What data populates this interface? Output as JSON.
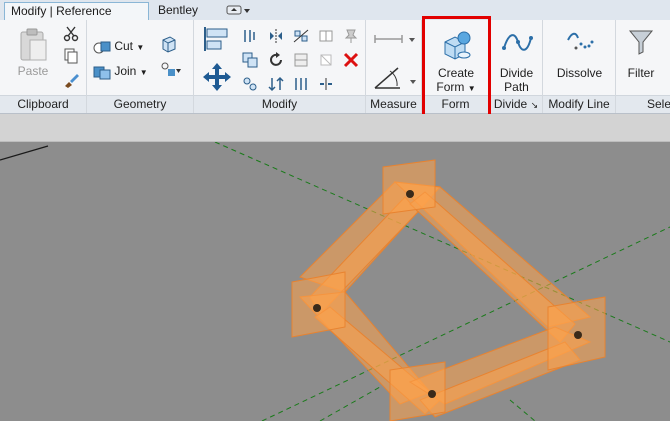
{
  "tabs": {
    "active_label": "Modify | Reference Lines",
    "second_label": "Bentley",
    "third_label": "▾"
  },
  "panels": {
    "clipboard": {
      "title": "Clipboard",
      "paste_label": "Paste"
    },
    "geometry": {
      "title": "Geometry",
      "cut_label": "Cut",
      "join_label": "Join"
    },
    "modify": {
      "title": "Modify"
    },
    "measure": {
      "title": "Measure"
    },
    "form": {
      "title": "Form",
      "create_form_line1": "Create",
      "create_form_line2": "Form"
    },
    "divide": {
      "title": "Divide",
      "divide_path_line1": "Divide",
      "divide_path_line2": "Path"
    },
    "modify_line": {
      "title": "Modify Line",
      "dissolve_label": "Dissolve"
    },
    "select": {
      "title": "Sele",
      "filter_label": "Filter"
    }
  },
  "colors": {
    "accent": "#4a90c8",
    "highlight": "#e20000",
    "geometry": "#ffa24a",
    "guides": "#1a7a1a"
  }
}
